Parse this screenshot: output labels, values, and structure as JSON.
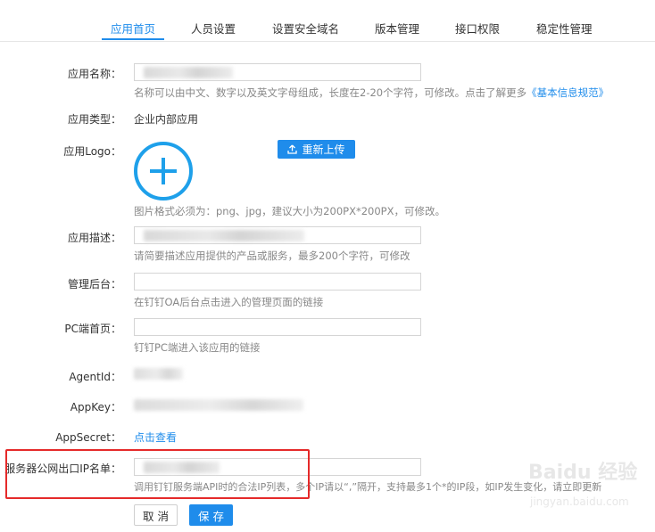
{
  "tabs": [
    {
      "label": "应用首页",
      "active": true
    },
    {
      "label": "人员设置",
      "active": false
    },
    {
      "label": "设置安全域名",
      "active": false
    },
    {
      "label": "版本管理",
      "active": false
    },
    {
      "label": "接口权限",
      "active": false
    },
    {
      "label": "稳定性管理",
      "active": false
    }
  ],
  "form": {
    "app_name": {
      "label": "应用名称：",
      "hint_text": "名称可以由中文、数字以及英文字母组成，长度在2-20个字符，可修改。点击了解更多",
      "hint_link": "《基本信息规范》"
    },
    "app_type": {
      "label": "应用类型：",
      "value": "企业内部应用"
    },
    "logo": {
      "label": "应用Logo：",
      "upload_label": "重新上传",
      "hint": "图片格式必须为：png、jpg，建议大小为200PX*200PX，可修改。"
    },
    "description": {
      "label": "应用描述：",
      "hint": "请简要描述应用提供的产品或服务，最多200个字符，可修改"
    },
    "admin": {
      "label": "管理后台：",
      "hint": "在钉钉OA后台点击进入的管理页面的链接"
    },
    "pc_home": {
      "label": "PC端首页：",
      "hint": "钉钉PC端进入该应用的链接"
    },
    "agent_id": {
      "label": "AgentId："
    },
    "app_key": {
      "label": "AppKey："
    },
    "app_secret": {
      "label": "AppSecret：",
      "link": "点击查看"
    },
    "ip_whitelist": {
      "label": "服务器公网出口IP名单：",
      "hint": "调用钉钉服务端API时的合法IP列表，多个IP请以“,”隔开，支持最多1个*的IP段，如IP发生变化，请立即更新"
    }
  },
  "buttons": {
    "cancel": "取 消",
    "save": "保 存"
  },
  "watermark": {
    "brand": "Baidu 经验",
    "url": "jingyan.baidu.com"
  },
  "colors": {
    "accent": "#1f8ceb",
    "highlight": "#e52a2a",
    "hint": "#888888"
  }
}
